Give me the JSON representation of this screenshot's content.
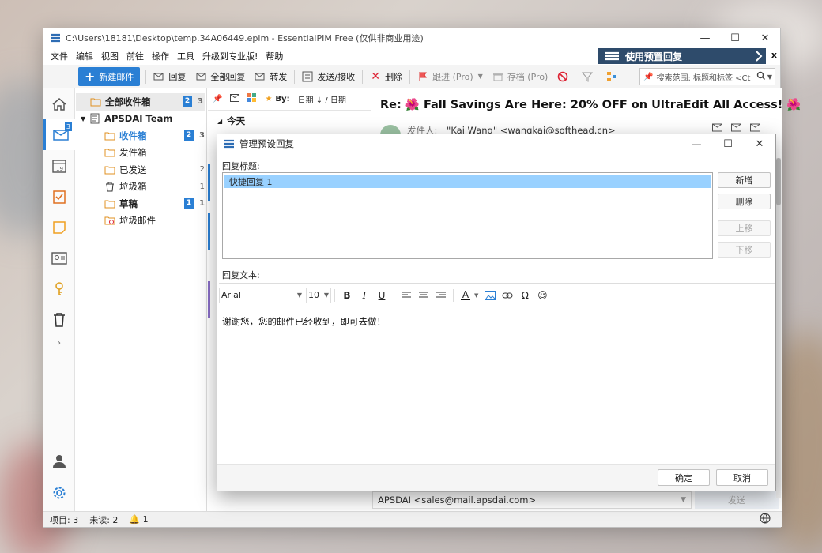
{
  "window": {
    "title": "C:\\Users\\18181\\Desktop\\temp.34A06449.epim - EssentialPIM Free (仅供非商业用途)"
  },
  "menu": [
    "文件",
    "编辑",
    "视图",
    "前往",
    "操作",
    "工具",
    "升级到专业版!",
    "帮助"
  ],
  "banner": {
    "label": "使用预置回复",
    "close": "x"
  },
  "toolbar": {
    "new_mail": "新建邮件",
    "reply": "回复",
    "reply_all": "全部回复",
    "forward": "转发",
    "send_receive": "发送/接收",
    "delete": "删除",
    "follow_up": "跟进 (Pro)",
    "archive": "存档 (Pro)",
    "search_placeholder": "搜索范围: 标题和标签 <Ct"
  },
  "leftbar": {
    "mail_badge": "3"
  },
  "folders": {
    "all_inbox": {
      "label": "全部收件箱",
      "unread": "2",
      "count": "3"
    },
    "account": "APSDAI Team",
    "items": [
      {
        "label": "收件箱",
        "unread": "2",
        "count": "3"
      },
      {
        "label": "发件箱",
        "unread": "",
        "count": ""
      },
      {
        "label": "已发送",
        "unread": "",
        "count": "2"
      },
      {
        "label": "垃圾箱",
        "unread": "",
        "count": "1"
      },
      {
        "label": "草稿",
        "unread": "1",
        "count": "1"
      },
      {
        "label": "垃圾邮件",
        "unread": "",
        "count": ""
      }
    ]
  },
  "list": {
    "sort_by": "By:",
    "sort_field": "日期 ↓ / 日期",
    "group_today": "今天"
  },
  "reader": {
    "subject": "Re: 🌺 Fall Savings Are Here: 20% OFF on UltraEdit All Access! 🌺",
    "sender_label": "发件人:",
    "sender": "\"Kai Wang\" <wangkai@softhead.cn>",
    "from_account": "APSDAI <sales@mail.apsdai.com>",
    "send": "发送"
  },
  "status": {
    "items": "项目: 3",
    "unread": "未读: 2",
    "alerts": "1"
  },
  "dialog": {
    "title": "管理预设回复",
    "reply_title_label": "回复标题:",
    "replies": [
      "快捷回复 1"
    ],
    "buttons": {
      "add": "新增",
      "delete": "删除",
      "up": "上移",
      "down": "下移"
    },
    "reply_text_label": "回复文本:",
    "font": "Arial",
    "size": "10",
    "body": "谢谢您，您的邮件已经收到，即可去做！",
    "ok": "确定",
    "cancel": "取消"
  },
  "colors": {
    "accent": "#2a7fd4",
    "banner": "#2e4b6b",
    "selection": "#99d1ff"
  }
}
